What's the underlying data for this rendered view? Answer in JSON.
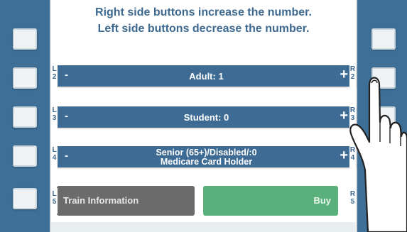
{
  "instructions": {
    "line1": "Right side buttons increase the number.",
    "line2": "Left side buttons decrease the number."
  },
  "rows": [
    {
      "left_letter": "L",
      "left_num": "2",
      "minus": "-",
      "label": "Adult: 1",
      "plus": "+",
      "right_letter": "R",
      "right_num": "2"
    },
    {
      "left_letter": "L",
      "left_num": "3",
      "minus": "-",
      "label": "Student: 0",
      "plus": "+",
      "right_letter": "R",
      "right_num": "3"
    },
    {
      "left_letter": "L",
      "left_num": "4",
      "minus": "-",
      "label_line1": "Senior (65+)/Disabled/:0",
      "label_line2": "Medicare Card Holder",
      "plus": "+",
      "right_letter": "R",
      "right_num": "4"
    }
  ],
  "bottom": {
    "left_letter": "L",
    "left_num": "5",
    "train_info": "Train Information",
    "buy": "Buy",
    "right_letter": "R",
    "right_num": "5"
  },
  "colors": {
    "bezel": "#3e6f97",
    "row": "#3d6b94",
    "train_button": "#6b6b6b",
    "buy_button": "#5ab07a"
  },
  "icons": [
    "pointing-hand-icon"
  ]
}
